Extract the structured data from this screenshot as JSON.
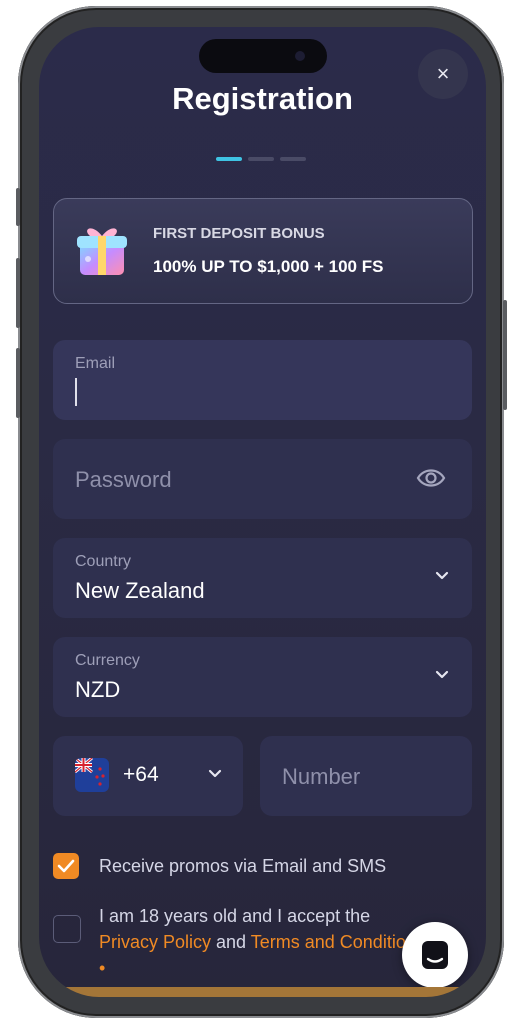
{
  "header": {
    "title": "Registration",
    "close_label": "×"
  },
  "progress": {
    "current_step": 1,
    "total_steps": 3
  },
  "bonus": {
    "headline": "FIRST DEPOSIT BONUS",
    "offer": "100% UP TO $1,000 + 100 FS"
  },
  "form": {
    "email": {
      "label": "Email",
      "value": ""
    },
    "password": {
      "placeholder": "Password"
    },
    "country": {
      "label": "Country",
      "value": "New Zealand"
    },
    "currency": {
      "label": "Currency",
      "value": "NZD"
    },
    "phone": {
      "code": "+64",
      "placeholder": "Number"
    }
  },
  "consents": {
    "promos": {
      "label": "Receive promos via Email and SMS",
      "checked": true
    },
    "terms": {
      "text_1": "I am 18 years old and I accept the ",
      "link_1": "Privacy Policy",
      "text_2": " and ",
      "link_2": "Terms and Conditions",
      "required_mark": " •",
      "checked": false
    }
  },
  "colors": {
    "accent": "#f08a24",
    "progress_active": "#3fc3e3",
    "background": "#2a2a44"
  },
  "icons": [
    "close-icon",
    "gift-icon",
    "eye-icon",
    "chevron-down-icon",
    "flag-nz-icon",
    "check-icon",
    "chat-icon"
  ]
}
